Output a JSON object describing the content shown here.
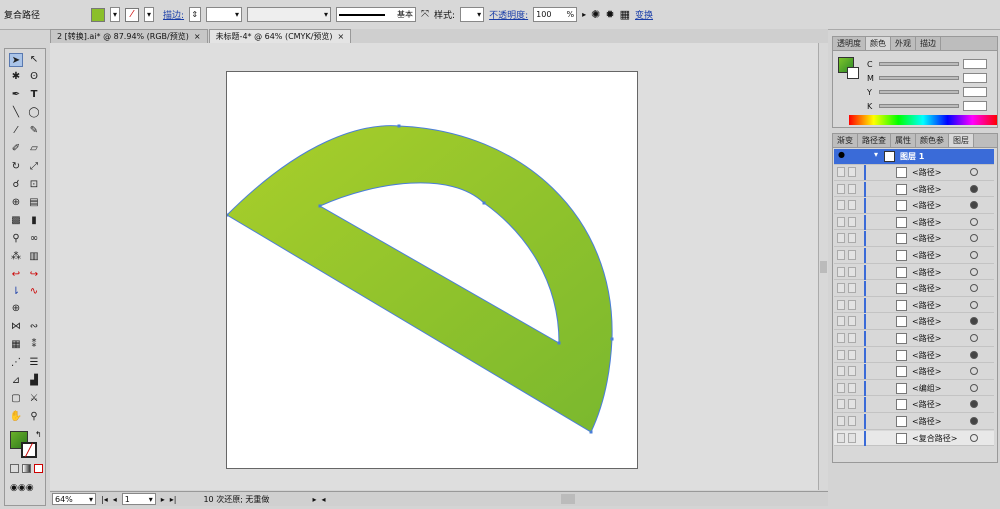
{
  "control_bar": {
    "object_type": "复合路径",
    "stroke_label": "描边:",
    "stroke_style": "基本",
    "style_label": "样式:",
    "opacity_label": "不透明度:",
    "opacity_value": "100",
    "opacity_unit": "%",
    "transform_label": "变换",
    "fill_color": "#8bbf2a"
  },
  "doc_tabs": [
    {
      "label": "2 [转换].ai* @ 87.94% (RGB/预览)",
      "close": "×"
    },
    {
      "label": "未标题-4* @ 64% (CMYK/预览)",
      "close": "×"
    }
  ],
  "status_bar": {
    "zoom": "64%",
    "page": "1",
    "undo_text": "10 次还原; 无重做"
  },
  "color_panel": {
    "tabs": [
      "透明度",
      "颜色",
      "外观",
      "描边"
    ],
    "active_tab": "颜色",
    "channels": [
      "C",
      "M",
      "Y",
      "K"
    ]
  },
  "layers_panel": {
    "tabs": [
      "渐变",
      "路径查",
      "属性",
      "颜色参",
      "图层"
    ],
    "active_tab": "图层",
    "layer_name": "图层 1",
    "items": [
      {
        "label": "<路径>",
        "target": "empty"
      },
      {
        "label": "<路径>",
        "target": "filled"
      },
      {
        "label": "<路径>",
        "target": "filled"
      },
      {
        "label": "<路径>",
        "target": "empty"
      },
      {
        "label": "<路径>",
        "target": "empty"
      },
      {
        "label": "<路径>",
        "target": "empty"
      },
      {
        "label": "<路径>",
        "target": "empty"
      },
      {
        "label": "<路径>",
        "target": "empty"
      },
      {
        "label": "<路径>",
        "target": "empty"
      },
      {
        "label": "<路径>",
        "target": "filled"
      },
      {
        "label": "<路径>",
        "target": "empty"
      },
      {
        "label": "<路径>",
        "target": "filled"
      },
      {
        "label": "<路径>",
        "target": "empty"
      },
      {
        "label": "<编组>",
        "target": "empty"
      },
      {
        "label": "<路径>",
        "target": "filled"
      },
      {
        "label": "<路径>",
        "target": "filled"
      },
      {
        "label": "<复合路径>",
        "target": "selected"
      }
    ]
  },
  "artwork": {
    "gradient_start": "#a9cf2a",
    "gradient_end": "#7ab82e",
    "path_color": "#4a7ed8"
  }
}
